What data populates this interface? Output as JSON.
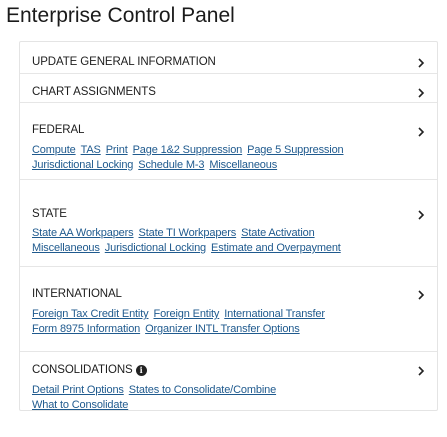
{
  "page": {
    "title": "Enterprise Control Panel"
  },
  "sections": {
    "update": {
      "label": "UPDATE GENERAL INFORMATION"
    },
    "chart": {
      "label": "CHART ASSIGNMENTS"
    },
    "federal": {
      "label": "FEDERAL",
      "links": [
        "Compute",
        "TAS",
        "Print",
        "Page 1&2 Suppression",
        "Page 5 Suppression",
        "Jurisdictional Locking",
        "Schedule M-3",
        "Miscellaneous"
      ]
    },
    "state": {
      "label": "STATE",
      "links": [
        "State AA Workpapers",
        "State TI Workpapers",
        "State Activation",
        "Miscellaneous",
        "Jurisdictional Locking",
        "Estimate and Overpayment"
      ]
    },
    "international": {
      "label": "INTERNATIONAL",
      "links": [
        "Foreign Tax Credit Entity",
        "Foreign Entity",
        "International Transfer",
        "Form 8975 Information",
        "Organizer INTL Transfer Options"
      ]
    },
    "consolidations": {
      "label": "CONSOLIDATIONS",
      "info_icon": "i",
      "links": [
        "Detail Print Options",
        "States to Consolidate/Combine",
        "What to Consolidate"
      ]
    }
  },
  "icons": {
    "chevron": "chevron-right-icon",
    "info": "info-circle-icon"
  },
  "colors": {
    "link": "#1f5a8e",
    "divider": "#e6e6e6"
  }
}
